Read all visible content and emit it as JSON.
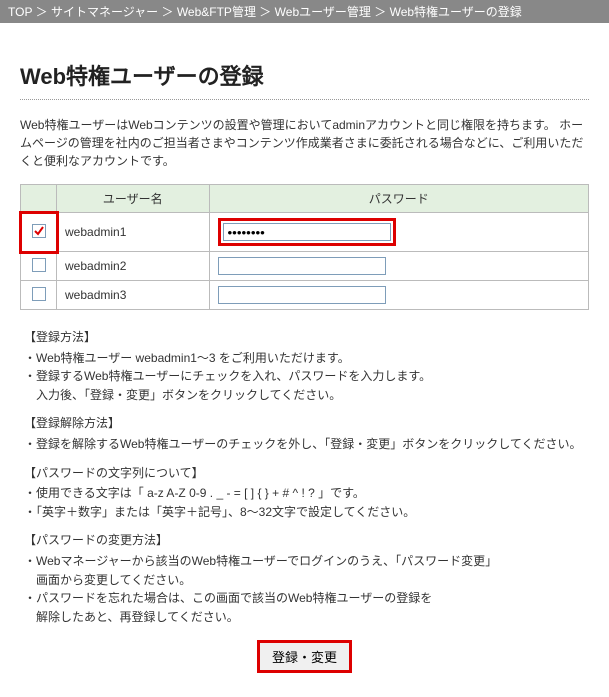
{
  "breadcrumb": {
    "items": [
      "TOP",
      "サイトマネージャー",
      "Web&FTP管理",
      "Webユーザー管理",
      "Web特権ユーザーの登録"
    ],
    "sep": "＞"
  },
  "page_title": "Web特権ユーザーの登録",
  "description": "Web特権ユーザーはWebコンテンツの設置や管理においてadminアカウントと同じ権限を持ちます。\nホームページの管理を社内のご担当者さまやコンテンツ作成業者さまに委託される場合などに、ご利用いただくと便利なアカウントです。",
  "table": {
    "headers": {
      "user": "ユーザー名",
      "password": "パスワード"
    },
    "rows": [
      {
        "checked": true,
        "highlight": true,
        "user": "webadmin1",
        "password": "●●●●●●●●"
      },
      {
        "checked": false,
        "highlight": false,
        "user": "webadmin2",
        "password": ""
      },
      {
        "checked": false,
        "highlight": false,
        "user": "webadmin3",
        "password": ""
      }
    ]
  },
  "sections": {
    "register": {
      "head": "【登録方法】",
      "lines": [
        "・Web特権ユーザー webadmin1～3 をご利用いただけます。",
        "・登録するWeb特権ユーザーにチェックを入れ、パスワードを入力します。",
        "　入力後、「登録・変更」ボタンをクリックしてください。"
      ]
    },
    "unregister": {
      "head": "【登録解除方法】",
      "lines": [
        "・登録を解除するWeb特権ユーザーのチェックを外し、「登録・変更」ボタンをクリックしてください。"
      ]
    },
    "password_chars": {
      "head": "【パスワードの文字列について】",
      "lines": [
        "・使用できる文字は「 a-z A-Z 0-9 . _ - = [ ] { } + # ^ ! ? 」です。",
        "・「英字＋数字」または「英字＋記号」、8～32文字で設定してください。"
      ]
    },
    "password_change": {
      "head": "【パスワードの変更方法】",
      "lines": [
        "・Webマネージャーから該当のWeb特権ユーザーでログインのうえ、「パスワード変更」",
        "　画面から変更してください。",
        "・パスワードを忘れた場合は、この画面で該当のWeb特権ユーザーの登録を",
        "　解除したあと、再登録してください。"
      ]
    }
  },
  "submit_label": "登録・変更"
}
